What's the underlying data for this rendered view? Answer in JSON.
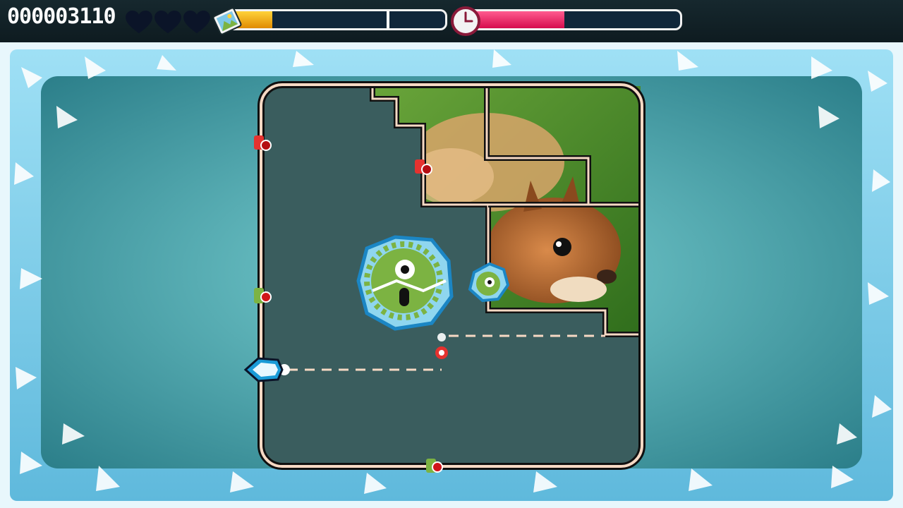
{
  "hud": {
    "score": "000003110",
    "lives_total": 3,
    "reveal_progress": 0.2,
    "reveal_goal": 0.73,
    "time_remaining": 0.45,
    "icons": [
      "heart-icon",
      "picture-icon",
      "clock-icon"
    ]
  },
  "board": {
    "image_subject": "red squirrel",
    "enemies": [
      "large-green-spiky-monster-in-ice",
      "small-green-monster-in-ice",
      "red-spiky-spark"
    ],
    "wall_crawlers": [
      "red-snail",
      "red-snail",
      "green-snail",
      "green-snail"
    ]
  },
  "colors": {
    "life_bar": "#f5a600",
    "time_bar": "#e8135a",
    "bar_bg": "#10263a",
    "ice": "#8fd6ef",
    "play_field": "#3a5d5e",
    "border": "#f6d9c4"
  }
}
